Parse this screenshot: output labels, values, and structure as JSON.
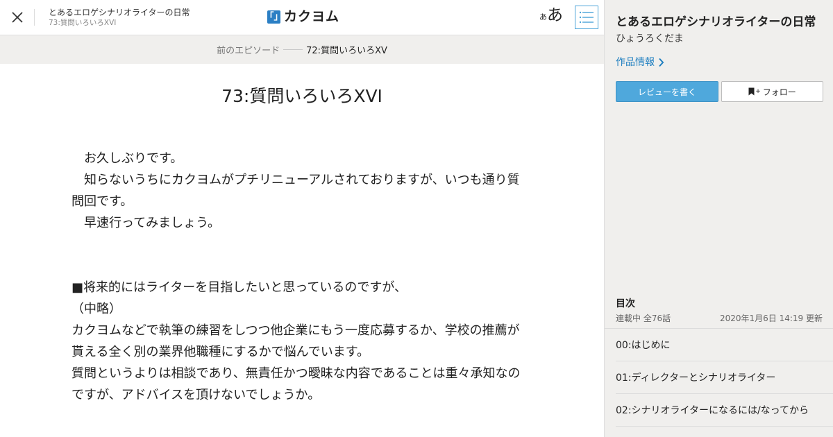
{
  "header": {
    "work_title": "とあるエロゲシナリオライターの日常",
    "episode_title": "73:質問いろいろXVI",
    "logo_mark": "「」",
    "logo_text": "カクヨム",
    "fontsize_small": "あ",
    "fontsize_large": "あ",
    "close_icon": "close-icon",
    "toc_icon": "list-icon"
  },
  "prev_bar": {
    "label": "前のエピソード",
    "title": "72:質問いろいろXV"
  },
  "main": {
    "title": "73:質問いろいろXVI",
    "paragraphs": [
      "　お久しぶりです。",
      "　知らないうちにカクヨムがプチリニューアルされておりますが、いつも通り質問回です。",
      "　早速行ってみましょう。",
      "",
      "",
      "■将来的にはライターを目指したいと思っているのですが、",
      "（中略）",
      "カクヨムなどで執筆の練習をしつつ他企業にもう一度応募するか、学校の推薦が貰える全く別の業界他職種にするかで悩んでいます。",
      "質問というよりは相談であり、無責任かつ曖昧な内容であることは重々承知なのですが、アドバイスを頂けないでしょうか。"
    ]
  },
  "sidebar": {
    "title": "とあるエロゲシナリオライターの日常",
    "author": "ひょうろくだま",
    "info_link": "作品情報",
    "review_button": "レビューを書く",
    "follow_plus": "+",
    "follow_button": "フォロー",
    "toc_heading": "目次",
    "toc_status": "連載中 全76話",
    "toc_updated": "2020年1月6日 14:19 更新",
    "toc_items": [
      "00:はじめに",
      "01:ディレクターとシナリオライター",
      "02:シナリオライターになるには/なってから"
    ]
  },
  "colors": {
    "accent": "#4fa8dc",
    "link": "#1f7fc0",
    "logo": "#2b7fc4",
    "sidebar_bg": "#f0efed"
  }
}
